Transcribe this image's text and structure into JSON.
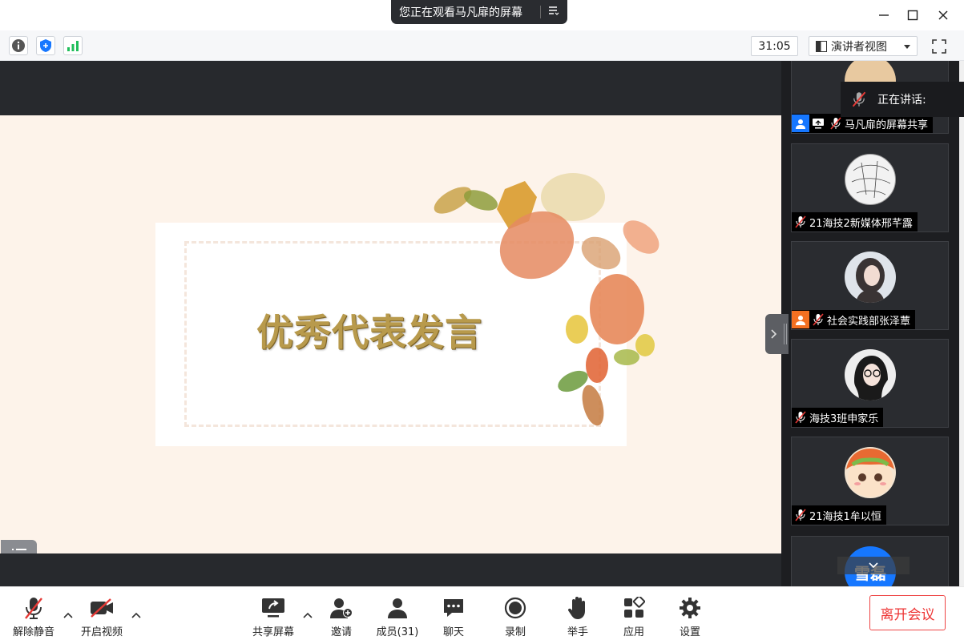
{
  "share_banner": {
    "text": "您正在观看马凡扉的屏幕",
    "menu_icon": "list-menu-icon"
  },
  "window_controls": {
    "minimize_icon": "minimize-icon",
    "maximize_icon": "maximize-icon",
    "close_icon": "close-icon"
  },
  "toolbar": {
    "info_icon": "info-icon",
    "security_icon": "shield-icon",
    "signal_icon": "signal-bars-icon",
    "timer": "31:05",
    "view_mode": "演讲者视图",
    "fullscreen_icon": "fullscreen-icon"
  },
  "slide": {
    "title": "优秀代表发言"
  },
  "speaking": {
    "label": "正在讲话:"
  },
  "participants": [
    {
      "name": "马凡扉的屏幕共享",
      "muted": true,
      "role": "host-share"
    },
    {
      "name": "21海技2新媒体邢芊露",
      "muted": true,
      "role": ""
    },
    {
      "name": "社会实践部张泽蕈",
      "muted": true,
      "role": "cohost"
    },
    {
      "name": "海技3班申家乐",
      "muted": true,
      "role": ""
    },
    {
      "name": "21海技1牟以恒",
      "muted": true,
      "role": ""
    },
    {
      "name": "雪磊",
      "muted": true,
      "role": ""
    }
  ],
  "bottombar": {
    "unmute": "解除静音",
    "start_video": "开启视频",
    "share_screen": "共享屏幕",
    "invite": "邀请",
    "members": "成员(31)",
    "chat": "聊天",
    "record": "录制",
    "raise_hand": "举手",
    "apps": "应用",
    "settings": "设置",
    "leave": "离开会议"
  },
  "colors": {
    "accent_red": "#e53935",
    "brand_blue": "#1677ff",
    "signal_green": "#1fbe5a",
    "slide_bg": "#fdf3ea",
    "title_gold": "#b89a4c"
  }
}
